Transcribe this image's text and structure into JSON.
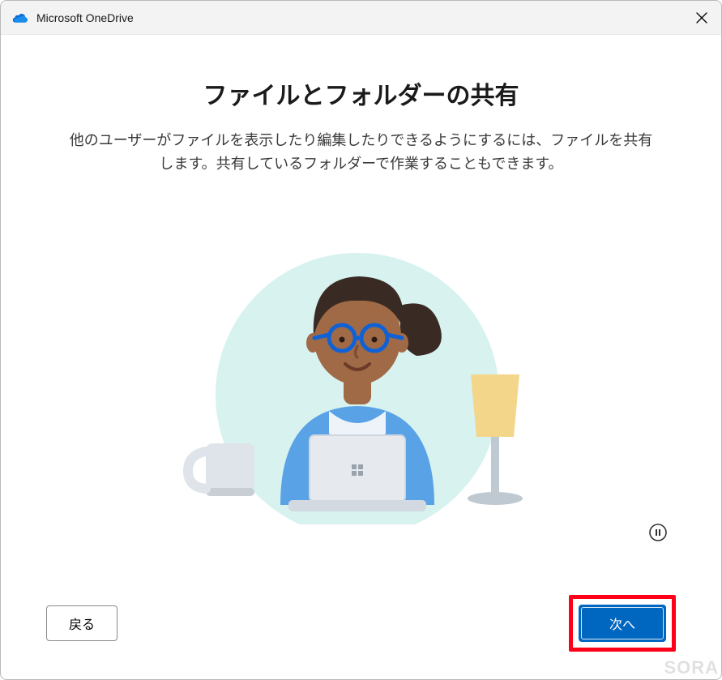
{
  "app": {
    "title": "Microsoft OneDrive"
  },
  "page": {
    "heading": "ファイルとフォルダーの共有",
    "subheading": "他のユーザーがファイルを表示したり編集したりできるようにするには、ファイルを共有します。共有しているフォルダーで作業することもできます。"
  },
  "buttons": {
    "back": "戻る",
    "next": "次へ"
  },
  "watermark": "SORA"
}
